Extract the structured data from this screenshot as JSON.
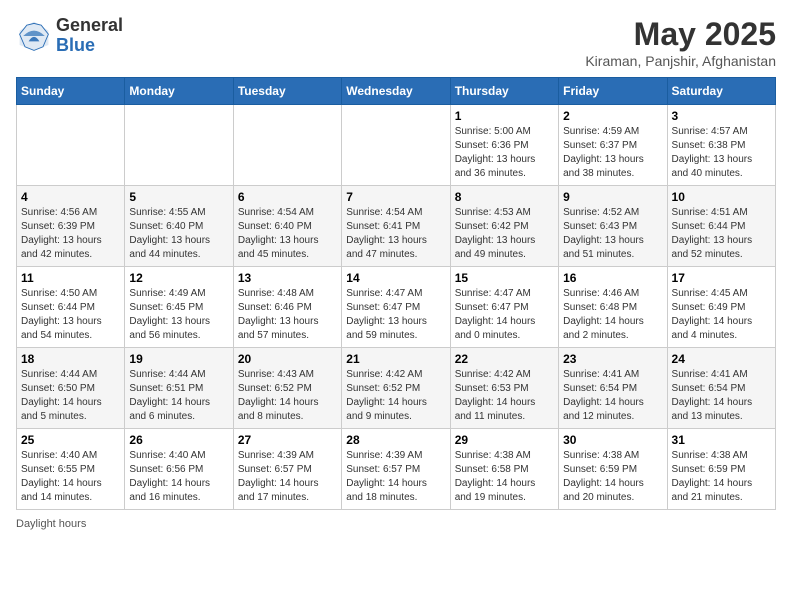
{
  "header": {
    "logo_general": "General",
    "logo_blue": "Blue",
    "month_title": "May 2025",
    "location": "Kiraman, Panjshir, Afghanistan"
  },
  "days_of_week": [
    "Sunday",
    "Monday",
    "Tuesday",
    "Wednesday",
    "Thursday",
    "Friday",
    "Saturday"
  ],
  "weeks": [
    [
      {
        "day": "",
        "info": ""
      },
      {
        "day": "",
        "info": ""
      },
      {
        "day": "",
        "info": ""
      },
      {
        "day": "",
        "info": ""
      },
      {
        "day": "1",
        "info": "Sunrise: 5:00 AM\nSunset: 6:36 PM\nDaylight: 13 hours\nand 36 minutes."
      },
      {
        "day": "2",
        "info": "Sunrise: 4:59 AM\nSunset: 6:37 PM\nDaylight: 13 hours\nand 38 minutes."
      },
      {
        "day": "3",
        "info": "Sunrise: 4:57 AM\nSunset: 6:38 PM\nDaylight: 13 hours\nand 40 minutes."
      }
    ],
    [
      {
        "day": "4",
        "info": "Sunrise: 4:56 AM\nSunset: 6:39 PM\nDaylight: 13 hours\nand 42 minutes."
      },
      {
        "day": "5",
        "info": "Sunrise: 4:55 AM\nSunset: 6:40 PM\nDaylight: 13 hours\nand 44 minutes."
      },
      {
        "day": "6",
        "info": "Sunrise: 4:54 AM\nSunset: 6:40 PM\nDaylight: 13 hours\nand 45 minutes."
      },
      {
        "day": "7",
        "info": "Sunrise: 4:54 AM\nSunset: 6:41 PM\nDaylight: 13 hours\nand 47 minutes."
      },
      {
        "day": "8",
        "info": "Sunrise: 4:53 AM\nSunset: 6:42 PM\nDaylight: 13 hours\nand 49 minutes."
      },
      {
        "day": "9",
        "info": "Sunrise: 4:52 AM\nSunset: 6:43 PM\nDaylight: 13 hours\nand 51 minutes."
      },
      {
        "day": "10",
        "info": "Sunrise: 4:51 AM\nSunset: 6:44 PM\nDaylight: 13 hours\nand 52 minutes."
      }
    ],
    [
      {
        "day": "11",
        "info": "Sunrise: 4:50 AM\nSunset: 6:44 PM\nDaylight: 13 hours\nand 54 minutes."
      },
      {
        "day": "12",
        "info": "Sunrise: 4:49 AM\nSunset: 6:45 PM\nDaylight: 13 hours\nand 56 minutes."
      },
      {
        "day": "13",
        "info": "Sunrise: 4:48 AM\nSunset: 6:46 PM\nDaylight: 13 hours\nand 57 minutes."
      },
      {
        "day": "14",
        "info": "Sunrise: 4:47 AM\nSunset: 6:47 PM\nDaylight: 13 hours\nand 59 minutes."
      },
      {
        "day": "15",
        "info": "Sunrise: 4:47 AM\nSunset: 6:47 PM\nDaylight: 14 hours\nand 0 minutes."
      },
      {
        "day": "16",
        "info": "Sunrise: 4:46 AM\nSunset: 6:48 PM\nDaylight: 14 hours\nand 2 minutes."
      },
      {
        "day": "17",
        "info": "Sunrise: 4:45 AM\nSunset: 6:49 PM\nDaylight: 14 hours\nand 4 minutes."
      }
    ],
    [
      {
        "day": "18",
        "info": "Sunrise: 4:44 AM\nSunset: 6:50 PM\nDaylight: 14 hours\nand 5 minutes."
      },
      {
        "day": "19",
        "info": "Sunrise: 4:44 AM\nSunset: 6:51 PM\nDaylight: 14 hours\nand 6 minutes."
      },
      {
        "day": "20",
        "info": "Sunrise: 4:43 AM\nSunset: 6:52 PM\nDaylight: 14 hours\nand 8 minutes."
      },
      {
        "day": "21",
        "info": "Sunrise: 4:42 AM\nSunset: 6:52 PM\nDaylight: 14 hours\nand 9 minutes."
      },
      {
        "day": "22",
        "info": "Sunrise: 4:42 AM\nSunset: 6:53 PM\nDaylight: 14 hours\nand 11 minutes."
      },
      {
        "day": "23",
        "info": "Sunrise: 4:41 AM\nSunset: 6:54 PM\nDaylight: 14 hours\nand 12 minutes."
      },
      {
        "day": "24",
        "info": "Sunrise: 4:41 AM\nSunset: 6:54 PM\nDaylight: 14 hours\nand 13 minutes."
      }
    ],
    [
      {
        "day": "25",
        "info": "Sunrise: 4:40 AM\nSunset: 6:55 PM\nDaylight: 14 hours\nand 14 minutes."
      },
      {
        "day": "26",
        "info": "Sunrise: 4:40 AM\nSunset: 6:56 PM\nDaylight: 14 hours\nand 16 minutes."
      },
      {
        "day": "27",
        "info": "Sunrise: 4:39 AM\nSunset: 6:57 PM\nDaylight: 14 hours\nand 17 minutes."
      },
      {
        "day": "28",
        "info": "Sunrise: 4:39 AM\nSunset: 6:57 PM\nDaylight: 14 hours\nand 18 minutes."
      },
      {
        "day": "29",
        "info": "Sunrise: 4:38 AM\nSunset: 6:58 PM\nDaylight: 14 hours\nand 19 minutes."
      },
      {
        "day": "30",
        "info": "Sunrise: 4:38 AM\nSunset: 6:59 PM\nDaylight: 14 hours\nand 20 minutes."
      },
      {
        "day": "31",
        "info": "Sunrise: 4:38 AM\nSunset: 6:59 PM\nDaylight: 14 hours\nand 21 minutes."
      }
    ]
  ],
  "footer": {
    "note": "Daylight hours"
  }
}
